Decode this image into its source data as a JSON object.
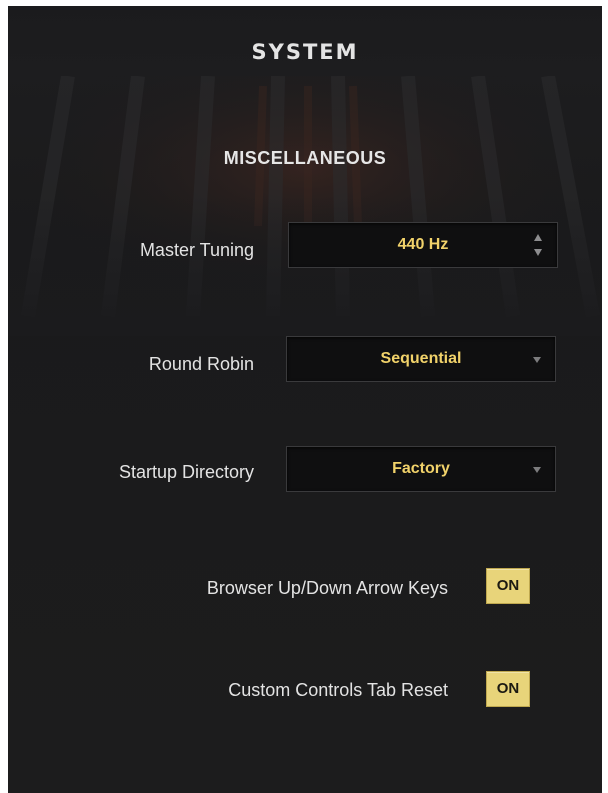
{
  "panel": {
    "title": "SYSTEM",
    "section_heading": "MISCELLANEOUS"
  },
  "settings": {
    "master_tuning": {
      "label": "Master Tuning",
      "value": "440 Hz",
      "control": "stepper",
      "icon": "up-down-stepper-icon"
    },
    "round_robin": {
      "label": "Round Robin",
      "value": "Sequential",
      "control": "dropdown",
      "icon": "dropdown-arrow-icon"
    },
    "startup_directory": {
      "label": "Startup Directory",
      "value": "Factory",
      "control": "dropdown",
      "icon": "dropdown-arrow-icon"
    },
    "browser_arrow_keys": {
      "label": "Browser Up/Down Arrow Keys",
      "value": "ON",
      "control": "toggle"
    },
    "custom_controls_tab_reset": {
      "label": "Custom Controls Tab Reset",
      "value": "ON",
      "control": "toggle"
    }
  },
  "colors": {
    "background": "#1b1b1d",
    "field_background": "#0f0f10",
    "value_text": "#f1d26a",
    "toggle_on": "#e8d47a",
    "label_text": "#e3e3e3"
  }
}
